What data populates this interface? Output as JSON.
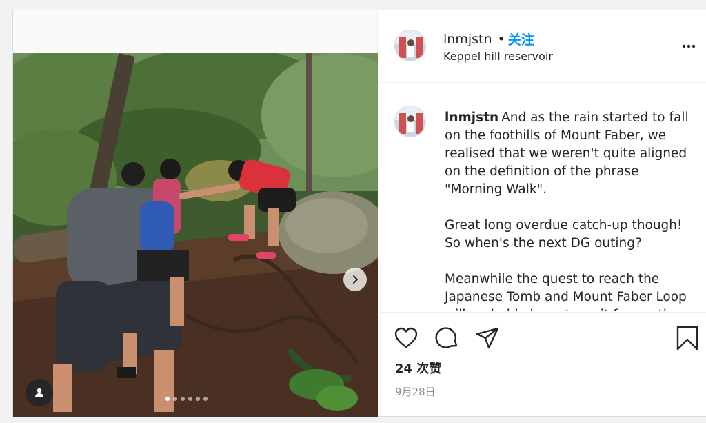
{
  "post": {
    "username": "lnmjstn",
    "separator": "•",
    "follow_label": "关注",
    "location": "Keppel hill reservoir",
    "caption": {
      "username": "lnmjstn",
      "paragraphs": [
        "And as the rain started to fall on the foothills of Mount Faber, we realised that we weren't quite aligned on the definition of the phrase \"Morning Walk\".",
        "Great long overdue catch-up though! So when's the next DG outing?",
        "Meanwhile the quest to reach the Japanese Tomb and Mount Faber Loop will probably have to wait for another day."
      ]
    },
    "likes": "24 次赞",
    "date": "9月28日",
    "carousel": {
      "count": 6,
      "active_index": 0
    },
    "icons": {
      "like": "heart-icon",
      "comment": "comment-bubble-icon",
      "share": "paper-plane-icon",
      "save": "bookmark-icon",
      "more": "more-options-icon",
      "next": "chevron-right-icon",
      "tag": "user-tag-icon"
    },
    "colors": {
      "link": "#0095f6",
      "text": "#262626",
      "secondary": "#8e8e8e"
    }
  }
}
